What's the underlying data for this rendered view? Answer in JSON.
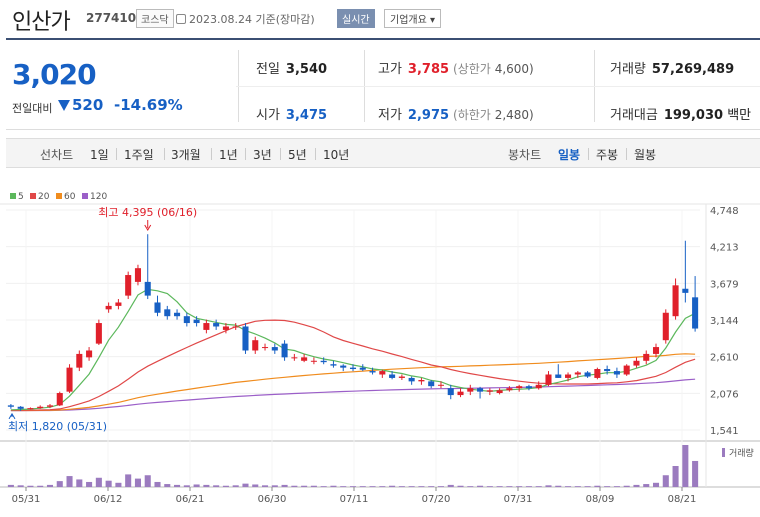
{
  "header": {
    "name": "인산가",
    "code": "277410",
    "market": "코스닥",
    "date": "2023.08.24 기준(장마감)",
    "realtime_label": "실시간",
    "company_label": "기업개요 ▾"
  },
  "quote": {
    "price": "3,020",
    "change_label": "전일대비",
    "change_amount": "520",
    "change_pct": "-14.69%",
    "prev_label": "전일",
    "prev": "3,540",
    "high_label": "고가",
    "high": "3,785",
    "upper_limit_label": "(상한가",
    "upper_limit": "4,600)",
    "volume_label": "거래량",
    "volume": "57,269,489",
    "open_label": "시가",
    "open": "3,475",
    "low_label": "저가",
    "low": "2,975",
    "lower_limit_label": "(하한가",
    "lower_limit": "2,480)",
    "amount_label": "거래대금",
    "amount": "199,030",
    "amount_unit": "백만"
  },
  "periods": {
    "line_label": "선차트",
    "line_items": [
      "1일",
      "1주일",
      "3개월",
      "1년",
      "3년",
      "5년",
      "10년"
    ],
    "candle_label": "봉차트",
    "candle_items": [
      "일봉",
      "주봉",
      "월봉"
    ],
    "active": "일봉"
  },
  "legend": [
    "5",
    "20",
    "60",
    "120"
  ],
  "colors": {
    "up": "#e0202b",
    "down": "#1760c4",
    "ma5": "#5cb85c",
    "ma20": "#e04848",
    "ma60": "#f08c1e",
    "ma120": "#9b5fc8",
    "volume": "#9b7bbf"
  },
  "chart_data": {
    "type": "candlestick",
    "y_ticks": [
      "4,748",
      "4,213",
      "3,679",
      "3,144",
      "2,610",
      "2,076",
      "1,541"
    ],
    "x_ticks": [
      "05/31",
      "06/12",
      "06/21",
      "06/30",
      "07/11",
      "07/20",
      "07/31",
      "08/09",
      "08/21"
    ],
    "ylim": [
      1541,
      4748
    ],
    "annotations": {
      "high": "최고 4,395 (06/16)",
      "low": "최저 1,820 (05/31)"
    },
    "volume_label": "거래량",
    "candles": [
      [
        1900,
        1920,
        1850,
        1880
      ],
      [
        1880,
        1890,
        1820,
        1850
      ],
      [
        1850,
        1870,
        1840,
        1860
      ],
      [
        1860,
        1900,
        1850,
        1880
      ],
      [
        1880,
        1920,
        1860,
        1900
      ],
      [
        1900,
        2100,
        1890,
        2080
      ],
      [
        2100,
        2500,
        2080,
        2450
      ],
      [
        2450,
        2700,
        2400,
        2650
      ],
      [
        2600,
        2750,
        2550,
        2700
      ],
      [
        2800,
        3150,
        2780,
        3100
      ],
      [
        3300,
        3400,
        3250,
        3350
      ],
      [
        3350,
        3450,
        3300,
        3400
      ],
      [
        3500,
        3850,
        3450,
        3800
      ],
      [
        3700,
        3950,
        3650,
        3900
      ],
      [
        3700,
        4395,
        3450,
        3500
      ],
      [
        3400,
        3500,
        3200,
        3250
      ],
      [
        3300,
        3350,
        3150,
        3200
      ],
      [
        3250,
        3300,
        3150,
        3200
      ],
      [
        3200,
        3250,
        3050,
        3100
      ],
      [
        3150,
        3200,
        3050,
        3100
      ],
      [
        3000,
        3150,
        2950,
        3100
      ],
      [
        3100,
        3150,
        3000,
        3050
      ],
      [
        3000,
        3100,
        2950,
        3050
      ],
      [
        3050,
        3100,
        3000,
        3050
      ],
      [
        3050,
        3100,
        2650,
        2700
      ],
      [
        2700,
        2900,
        2650,
        2850
      ],
      [
        2750,
        2800,
        2700,
        2750
      ],
      [
        2750,
        2800,
        2650,
        2700
      ],
      [
        2800,
        2850,
        2550,
        2600
      ],
      [
        2600,
        2650,
        2550,
        2600
      ],
      [
        2550,
        2650,
        2530,
        2600
      ],
      [
        2550,
        2600,
        2500,
        2550
      ],
      [
        2550,
        2600,
        2500,
        2530
      ],
      [
        2500,
        2550,
        2450,
        2480
      ],
      [
        2480,
        2500,
        2400,
        2450
      ],
      [
        2450,
        2500,
        2400,
        2430
      ],
      [
        2450,
        2500,
        2400,
        2420
      ],
      [
        2400,
        2450,
        2350,
        2380
      ],
      [
        2350,
        2420,
        2300,
        2400
      ],
      [
        2350,
        2400,
        2280,
        2300
      ],
      [
        2300,
        2350,
        2270,
        2320
      ],
      [
        2300,
        2320,
        2200,
        2250
      ],
      [
        2250,
        2300,
        2200,
        2270
      ],
      [
        2250,
        2270,
        2150,
        2180
      ],
      [
        2200,
        2250,
        2150,
        2200
      ],
      [
        2150,
        2200,
        1990,
        2050
      ],
      [
        2050,
        2150,
        2020,
        2100
      ],
      [
        2100,
        2200,
        2050,
        2150
      ],
      [
        2150,
        2170,
        2000,
        2100
      ],
      [
        2100,
        2150,
        2050,
        2120
      ],
      [
        2080,
        2150,
        2060,
        2120
      ],
      [
        2120,
        2180,
        2100,
        2150
      ],
      [
        2150,
        2200,
        2100,
        2180
      ],
      [
        2180,
        2200,
        2120,
        2150
      ],
      [
        2150,
        2250,
        2130,
        2200
      ],
      [
        2200,
        2400,
        2180,
        2350
      ],
      [
        2350,
        2500,
        2300,
        2300
      ],
      [
        2300,
        2380,
        2250,
        2350
      ],
      [
        2350,
        2400,
        2300,
        2380
      ],
      [
        2380,
        2400,
        2300,
        2320
      ],
      [
        2300,
        2450,
        2280,
        2430
      ],
      [
        2430,
        2480,
        2350,
        2400
      ],
      [
        2400,
        2450,
        2300,
        2350
      ],
      [
        2350,
        2500,
        2330,
        2480
      ],
      [
        2480,
        2600,
        2450,
        2550
      ],
      [
        2550,
        2700,
        2500,
        2650
      ],
      [
        2650,
        2800,
        2600,
        2750
      ],
      [
        2850,
        3300,
        2800,
        3250
      ],
      [
        3200,
        3750,
        3150,
        3650
      ],
      [
        3600,
        4300,
        3400,
        3540
      ],
      [
        3475,
        3785,
        2975,
        3020
      ]
    ],
    "volumes": [
      0.05,
      0.04,
      0.03,
      0.03,
      0.05,
      0.14,
      0.26,
      0.18,
      0.12,
      0.22,
      0.15,
      0.1,
      0.3,
      0.2,
      0.28,
      0.12,
      0.07,
      0.05,
      0.04,
      0.06,
      0.05,
      0.04,
      0.03,
      0.04,
      0.08,
      0.06,
      0.04,
      0.04,
      0.05,
      0.03,
      0.03,
      0.03,
      0.02,
      0.03,
      0.02,
      0.02,
      0.02,
      0.02,
      0.02,
      0.03,
      0.02,
      0.02,
      0.02,
      0.02,
      0.02,
      0.05,
      0.03,
      0.02,
      0.03,
      0.02,
      0.02,
      0.02,
      0.02,
      0.02,
      0.02,
      0.04,
      0.03,
      0.02,
      0.02,
      0.02,
      0.03,
      0.02,
      0.02,
      0.03,
      0.05,
      0.07,
      0.1,
      0.28,
      0.5,
      1.0,
      0.62
    ]
  }
}
